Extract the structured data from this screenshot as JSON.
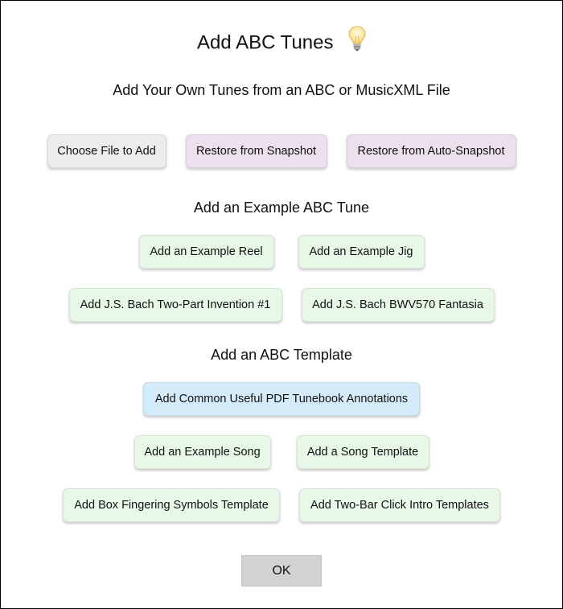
{
  "dialog": {
    "title": "Add ABC Tunes",
    "title_icon": "lightbulb-icon"
  },
  "file_section": {
    "heading": "Add Your Own Tunes from an ABC or MusicXML File",
    "buttons": [
      "Choose File to Add",
      "Restore from Snapshot",
      "Restore from Auto-Snapshot"
    ]
  },
  "example_section": {
    "heading": "Add an Example ABC Tune",
    "buttons": [
      "Add an Example Reel",
      "Add an Example Jig",
      "Add J.S. Bach Two-Part Invention #1",
      "Add J.S. Bach BWV570 Fantasia"
    ]
  },
  "template_section": {
    "heading": "Add an ABC Template",
    "buttons": [
      "Add Common Useful PDF Tunebook Annotations",
      "Add an Example Song",
      "Add a Song Template",
      "Add Box Fingering Symbols Template",
      "Add Two-Bar Click Intro Templates"
    ]
  },
  "ok_label": "OK",
  "colors": {
    "gray_button": "#ececec",
    "pink_button": "#ece0ec",
    "green_button": "#e8f8e8",
    "blue_button": "#d4ecfa",
    "ok_button": "#d2d2d2"
  }
}
